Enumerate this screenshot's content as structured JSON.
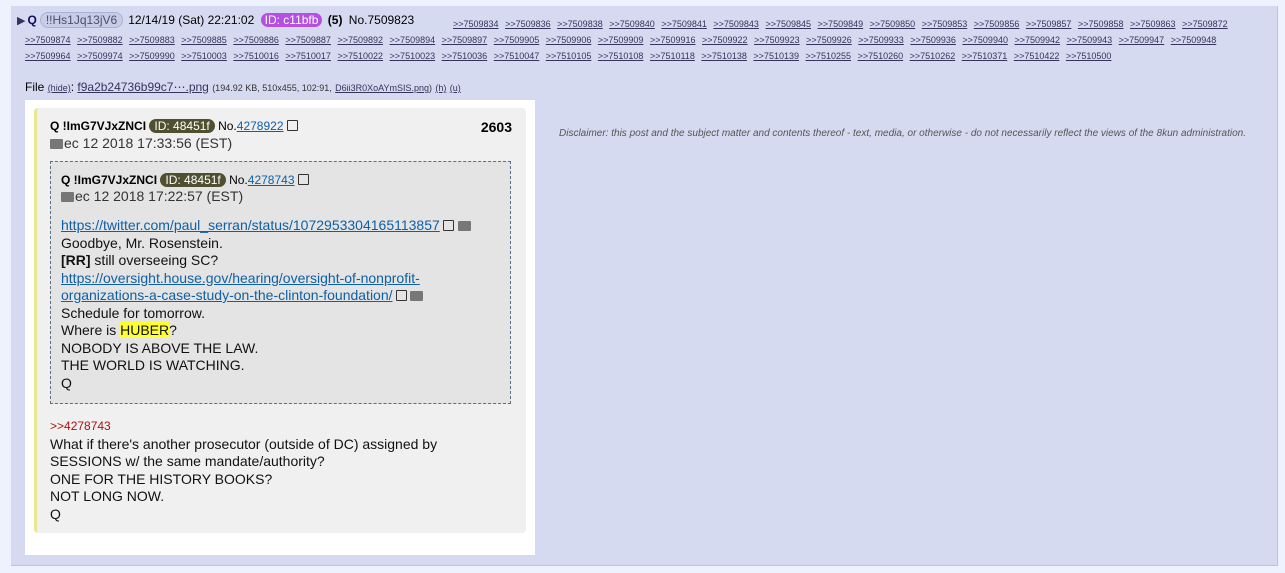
{
  "post": {
    "arrow": "▶",
    "subject": "Q",
    "tripcode": "!!Hs1Jq13jV6",
    "datetime": "12/14/19 (Sat) 22:21:02",
    "poster_id": "ID: c11bfb",
    "reply_count": "(5)",
    "post_number": "No.7509823",
    "backlinks": [
      ">>7509834",
      ">>7509836",
      ">>7509838",
      ">>7509840",
      ">>7509841",
      ">>7509843",
      ">>7509845",
      ">>7509849",
      ">>7509850",
      ">>7509853",
      ">>7509856",
      ">>7509857",
      ">>7509858",
      ">>7509863",
      ">>7509872",
      ">>7509874",
      ">>7509882",
      ">>7509883",
      ">>7509885",
      ">>7509886",
      ">>7509887",
      ">>7509892",
      ">>7509894",
      ">>7509897",
      ">>7509905",
      ">>7509906",
      ">>7509909",
      ">>7509916",
      ">>7509922",
      ">>7509923",
      ">>7509926",
      ">>7509933",
      ">>7509936",
      ">>7509940",
      ">>7509942",
      ">>7509943",
      ">>7509947",
      ">>7509948",
      ">>7509964",
      ">>7509974",
      ">>7509990",
      ">>7510003",
      ">>7510016",
      ">>7510017",
      ">>7510022",
      ">>7510023",
      ">>7510036",
      ">>7510047",
      ">>7510105",
      ">>7510108",
      ">>7510118",
      ">>7510138",
      ">>7510139",
      ">>7510255",
      ">>7510260",
      ">>7510262",
      ">>7510371",
      ">>7510422",
      ">>7510500"
    ],
    "file": {
      "label": "File",
      "hide": "(hide)",
      "sep": ":",
      "name": "f9a2b24736b99c7⋯.png",
      "meta": "(194.92 KB, 510x455, 102:91,",
      "orig_name": "D6ii3R0XoAYmSIS.png",
      "close": ")",
      "h": "(h)",
      "u": "(u)"
    }
  },
  "image": {
    "name": "Q !ImG7VJxZNCI",
    "id": "ID: 48451f",
    "no_prefix": "No.",
    "no": "4278922",
    "date": "ec 12 2018 17:33:56 (EST)",
    "count": "2603",
    "quoted": {
      "name": "Q !ImG7VJxZNCI",
      "id": "ID: 48451f",
      "no_prefix": "No.",
      "no": "4278743",
      "date": "ec 12 2018 17:22:57 (EST)",
      "link1": "https://twitter.com/paul_serran/status/1072953304165113857",
      "l1": "Goodbye, Mr. Rosenstein.",
      "rr": "[RR]",
      "l2": " still overseeing SC?",
      "link2a": "https://oversight.house.gov/hearing/oversight-of-nonprofit-",
      "link2b": "organizations-a-case-study-on-the-clinton-foundation/",
      "l3": "Schedule for tomorrow.",
      "l4a": "Where is ",
      "huber": "HUBER",
      "l4b": "?",
      "l5": "NOBODY IS ABOVE THE LAW.",
      "l6": "THE WORLD IS WATCHING.",
      "l7": "Q"
    },
    "reply": {
      "quotelink": ">>4278743",
      "l1": "What if there's another prosecutor (outside of DC) assigned by",
      "l2": "SESSIONS w/ the same mandate/authority?",
      "l3": "ONE FOR THE HISTORY BOOKS?",
      "l4": "NOT LONG NOW.",
      "l5": "Q"
    }
  },
  "disclaimer": "Disclaimer: this post and the subject matter and contents thereof - text, media, or otherwise - do not necessarily reflect the views of the 8kun administration.",
  "colors": {
    "poster_id_bg": "#b44fe0",
    "huber_highlight": "#ffff33",
    "link": "#0f5fa6"
  }
}
